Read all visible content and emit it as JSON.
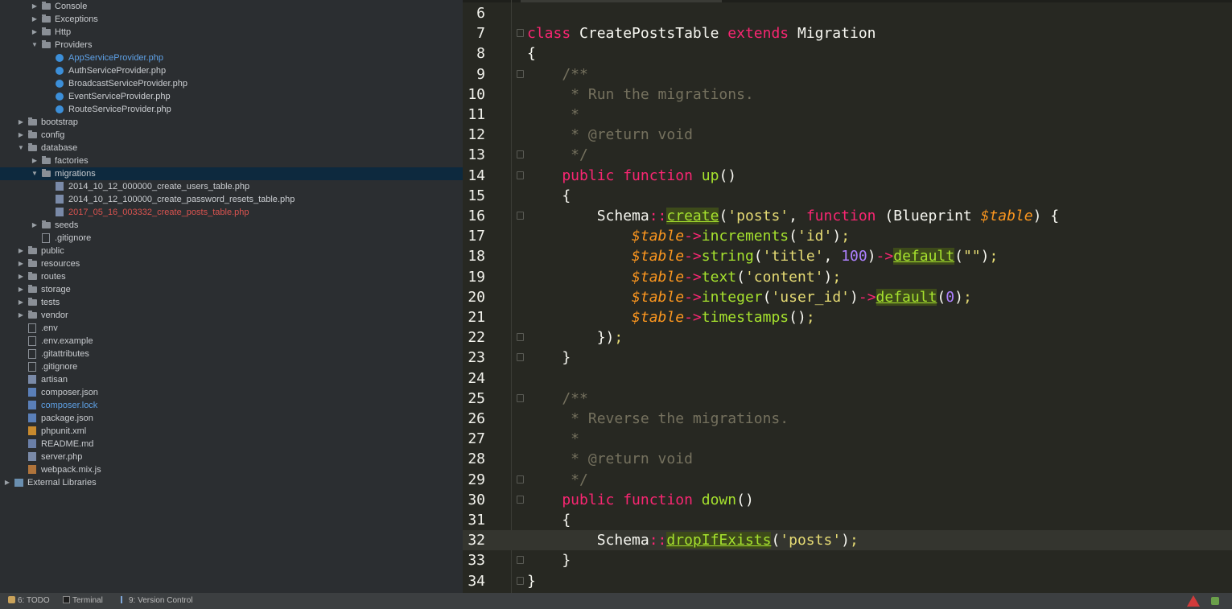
{
  "project_tree": [
    {
      "label": "Console",
      "indent": 2,
      "kind": "folder",
      "expanded": false
    },
    {
      "label": "Exceptions",
      "indent": 2,
      "kind": "folder",
      "expanded": false
    },
    {
      "label": "Http",
      "indent": 2,
      "kind": "folder",
      "expanded": false
    },
    {
      "label": "Providers",
      "indent": 2,
      "kind": "folder",
      "expanded": true
    },
    {
      "label": "AppServiceProvider.php",
      "indent": 3,
      "kind": "php-class",
      "color": "blue"
    },
    {
      "label": "AuthServiceProvider.php",
      "indent": 3,
      "kind": "php-class"
    },
    {
      "label": "BroadcastServiceProvider.php",
      "indent": 3,
      "kind": "php-class"
    },
    {
      "label": "EventServiceProvider.php",
      "indent": 3,
      "kind": "php-class"
    },
    {
      "label": "RouteServiceProvider.php",
      "indent": 3,
      "kind": "php-class"
    },
    {
      "label": "bootstrap",
      "indent": 1,
      "kind": "folder",
      "expanded": false
    },
    {
      "label": "config",
      "indent": 1,
      "kind": "folder",
      "expanded": false
    },
    {
      "label": "database",
      "indent": 1,
      "kind": "folder",
      "expanded": true
    },
    {
      "label": "factories",
      "indent": 2,
      "kind": "folder",
      "expanded": false
    },
    {
      "label": "migrations",
      "indent": 2,
      "kind": "folder",
      "expanded": true,
      "selected": true
    },
    {
      "label": "2014_10_12_000000_create_users_table.php",
      "indent": 3,
      "kind": "php-file"
    },
    {
      "label": "2014_10_12_100000_create_password_resets_table.php",
      "indent": 3,
      "kind": "php-file"
    },
    {
      "label": "2017_05_16_003332_create_posts_table.php",
      "indent": 3,
      "kind": "php-file",
      "color": "red"
    },
    {
      "label": "seeds",
      "indent": 2,
      "kind": "folder",
      "expanded": false
    },
    {
      "label": ".gitignore",
      "indent": 2,
      "kind": "file"
    },
    {
      "label": "public",
      "indent": 1,
      "kind": "folder",
      "expanded": false
    },
    {
      "label": "resources",
      "indent": 1,
      "kind": "folder",
      "expanded": false
    },
    {
      "label": "routes",
      "indent": 1,
      "kind": "folder",
      "expanded": false
    },
    {
      "label": "storage",
      "indent": 1,
      "kind": "folder",
      "expanded": false
    },
    {
      "label": "tests",
      "indent": 1,
      "kind": "folder",
      "expanded": false
    },
    {
      "label": "vendor",
      "indent": 1,
      "kind": "folder",
      "expanded": false
    },
    {
      "label": ".env",
      "indent": 1,
      "kind": "file"
    },
    {
      "label": ".env.example",
      "indent": 1,
      "kind": "file"
    },
    {
      "label": ".gitattributes",
      "indent": 1,
      "kind": "file"
    },
    {
      "label": ".gitignore",
      "indent": 1,
      "kind": "file"
    },
    {
      "label": "artisan",
      "indent": 1,
      "kind": "php-file"
    },
    {
      "label": "composer.json",
      "indent": 1,
      "kind": "json"
    },
    {
      "label": "composer.lock",
      "indent": 1,
      "kind": "json",
      "color": "blue"
    },
    {
      "label": "package.json",
      "indent": 1,
      "kind": "json"
    },
    {
      "label": "phpunit.xml",
      "indent": 1,
      "kind": "xml"
    },
    {
      "label": "README.md",
      "indent": 1,
      "kind": "md"
    },
    {
      "label": "server.php",
      "indent": 1,
      "kind": "php-file"
    },
    {
      "label": "webpack.mix.js",
      "indent": 1,
      "kind": "js"
    },
    {
      "label": "External Libraries",
      "indent": 0,
      "kind": "lib",
      "expanded": false
    }
  ],
  "editor": {
    "current_line": "32",
    "lines": [
      {
        "n": "6",
        "tokens": []
      },
      {
        "n": "7",
        "fold": true,
        "tokens": [
          [
            "kw",
            "class"
          ],
          [
            "t",
            " CreatePostsTable "
          ],
          [
            "kw",
            "extends"
          ],
          [
            "t",
            " Migration"
          ]
        ]
      },
      {
        "n": "8",
        "tokens": [
          [
            "t",
            "{"
          ]
        ]
      },
      {
        "n": "9",
        "fold": true,
        "tokens": [
          [
            "com",
            "    /**"
          ]
        ]
      },
      {
        "n": "10",
        "tokens": [
          [
            "com",
            "     * Run the migrations."
          ]
        ]
      },
      {
        "n": "11",
        "tokens": [
          [
            "com",
            "     *"
          ]
        ]
      },
      {
        "n": "12",
        "tokens": [
          [
            "com",
            "     * @return void"
          ]
        ]
      },
      {
        "n": "13",
        "fold": true,
        "tokens": [
          [
            "com",
            "     */"
          ]
        ]
      },
      {
        "n": "14",
        "fold": true,
        "tokens": [
          [
            "kw",
            "    public function "
          ],
          [
            "fn",
            "up"
          ],
          [
            "t",
            "()"
          ]
        ]
      },
      {
        "n": "15",
        "tokens": [
          [
            "t",
            "    {"
          ]
        ]
      },
      {
        "n": "16",
        "fold": true,
        "tokens": [
          [
            "t",
            "        Schema"
          ],
          [
            "op",
            "::"
          ],
          [
            "fnu",
            "create"
          ],
          [
            "t",
            "("
          ],
          [
            "str",
            "'posts'"
          ],
          [
            "t",
            ", "
          ],
          [
            "kw",
            "function"
          ],
          [
            "t",
            " (Blueprint "
          ],
          [
            "var",
            "$table"
          ],
          [
            "t",
            ") {"
          ]
        ]
      },
      {
        "n": "17",
        "tokens": [
          [
            "var",
            "            $table"
          ],
          [
            "op",
            "->"
          ],
          [
            "fn",
            "increments"
          ],
          [
            "t",
            "("
          ],
          [
            "str",
            "'id'"
          ],
          [
            "t",
            ")"
          ],
          [
            "str",
            ";"
          ]
        ]
      },
      {
        "n": "18",
        "tokens": [
          [
            "var",
            "            $table"
          ],
          [
            "op",
            "->"
          ],
          [
            "fn",
            "string"
          ],
          [
            "t",
            "("
          ],
          [
            "str",
            "'title'"
          ],
          [
            "t",
            ", "
          ],
          [
            "num",
            "100"
          ],
          [
            "t",
            ")"
          ],
          [
            "op",
            "->"
          ],
          [
            "fnu",
            "default"
          ],
          [
            "t",
            "("
          ],
          [
            "str",
            "\"\""
          ],
          [
            "t",
            ")"
          ],
          [
            "str",
            ";"
          ]
        ]
      },
      {
        "n": "19",
        "tokens": [
          [
            "var",
            "            $table"
          ],
          [
            "op",
            "->"
          ],
          [
            "fn",
            "text"
          ],
          [
            "t",
            "("
          ],
          [
            "str",
            "'content'"
          ],
          [
            "t",
            ")"
          ],
          [
            "str",
            ";"
          ]
        ]
      },
      {
        "n": "20",
        "tokens": [
          [
            "var",
            "            $table"
          ],
          [
            "op",
            "->"
          ],
          [
            "fn",
            "integer"
          ],
          [
            "t",
            "("
          ],
          [
            "str",
            "'user_id'"
          ],
          [
            "t",
            ")"
          ],
          [
            "op",
            "->"
          ],
          [
            "fnu",
            "default"
          ],
          [
            "t",
            "("
          ],
          [
            "num",
            "0"
          ],
          [
            "t",
            ")"
          ],
          [
            "str",
            ";"
          ]
        ]
      },
      {
        "n": "21",
        "tokens": [
          [
            "var",
            "            $table"
          ],
          [
            "op",
            "->"
          ],
          [
            "fn",
            "timestamps"
          ],
          [
            "t",
            "()"
          ],
          [
            "str",
            ";"
          ]
        ]
      },
      {
        "n": "22",
        "fold": true,
        "tokens": [
          [
            "t",
            "        })"
          ],
          [
            "str",
            ";"
          ]
        ]
      },
      {
        "n": "23",
        "fold": true,
        "tokens": [
          [
            "t",
            "    }"
          ]
        ]
      },
      {
        "n": "24",
        "tokens": []
      },
      {
        "n": "25",
        "fold": true,
        "tokens": [
          [
            "com",
            "    /**"
          ]
        ]
      },
      {
        "n": "26",
        "tokens": [
          [
            "com",
            "     * Reverse the migrations."
          ]
        ]
      },
      {
        "n": "27",
        "tokens": [
          [
            "com",
            "     *"
          ]
        ]
      },
      {
        "n": "28",
        "tokens": [
          [
            "com",
            "     * @return void"
          ]
        ]
      },
      {
        "n": "29",
        "fold": true,
        "tokens": [
          [
            "com",
            "     */"
          ]
        ]
      },
      {
        "n": "30",
        "fold": true,
        "tokens": [
          [
            "kw",
            "    public function "
          ],
          [
            "fn",
            "down"
          ],
          [
            "t",
            "()"
          ]
        ]
      },
      {
        "n": "31",
        "tokens": [
          [
            "t",
            "    {"
          ]
        ]
      },
      {
        "n": "32",
        "tokens": [
          [
            "t",
            "        Schema"
          ],
          [
            "op",
            "::"
          ],
          [
            "fnu",
            "dropIfExists"
          ],
          [
            "t",
            "("
          ],
          [
            "str",
            "'posts'"
          ],
          [
            "t",
            ")"
          ],
          [
            "str",
            ";"
          ]
        ]
      },
      {
        "n": "33",
        "fold": true,
        "tokens": [
          [
            "t",
            "    }"
          ]
        ]
      },
      {
        "n": "34",
        "fold": true,
        "tokens": [
          [
            "t",
            "}"
          ]
        ]
      }
    ]
  },
  "statusbar": {
    "todo_label": "6: TODO",
    "terminal_label": "Terminal",
    "vcs_label": "9: Version Control"
  }
}
